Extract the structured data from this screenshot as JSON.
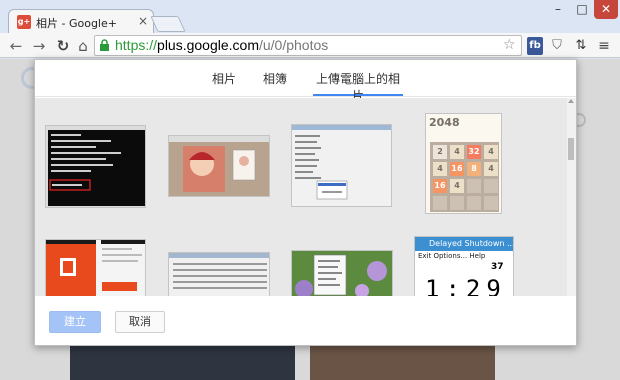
{
  "window": {
    "tab_title": "相片 - Google+",
    "favicon_label": "g+",
    "min_glyph": "–",
    "max_glyph": "□",
    "close_glyph": "✕"
  },
  "toolbar": {
    "url_scheme": "https://",
    "url_host": "plus.google.com",
    "url_path": "/u/0/photos",
    "ext_fb": "fb"
  },
  "dialog": {
    "tabs": [
      {
        "label": "相片",
        "active": false
      },
      {
        "label": "相簿",
        "active": false
      },
      {
        "label": "上傳電腦上的相片",
        "active": true
      }
    ],
    "create_label": "建立",
    "cancel_label": "取消"
  },
  "thumbs": {
    "game_title": "2048",
    "game_cells": [
      "2",
      "4",
      "32",
      "4",
      "4",
      "16",
      "8",
      "4",
      "16",
      "4",
      "",
      "",
      "",
      "",
      "",
      ""
    ],
    "delayed_title": "Delayed Shutdown ...",
    "delayed_menu": "Exit   Options...   Help",
    "delayed_count": "37",
    "delayed_time": "1:29"
  },
  "colors": {
    "accent": "#4285f4",
    "create_button": "#a4c3f6",
    "secure_green": "#2b9a3a",
    "close_red": "#c7463b"
  }
}
